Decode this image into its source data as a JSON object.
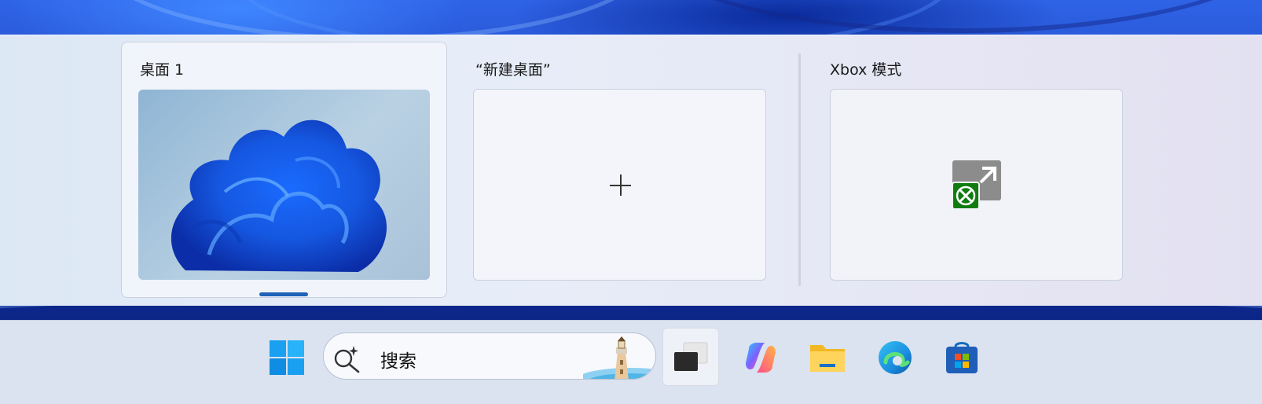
{
  "task_view": {
    "desktops": [
      {
        "title": "桌面 1",
        "active": true
      },
      {
        "title": "“新建桌面”"
      },
      {
        "title": "Xbox 模式"
      }
    ]
  },
  "taskbar": {
    "search_label": "搜索",
    "items": [
      {
        "name": "start-button"
      },
      {
        "name": "task-view-button",
        "active": true
      },
      {
        "name": "copilot-button"
      },
      {
        "name": "file-explorer-button"
      },
      {
        "name": "edge-button"
      },
      {
        "name": "microsoft-store-button"
      }
    ]
  },
  "colors": {
    "accent": "#1e63b8",
    "xbox_green": "#107c10"
  }
}
